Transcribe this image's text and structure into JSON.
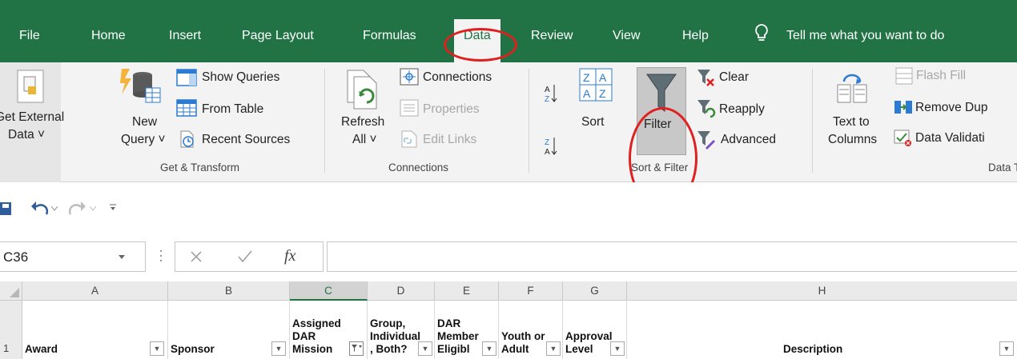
{
  "menu": {
    "tabs": [
      "File",
      "Home",
      "Insert",
      "Page Layout",
      "Formulas",
      "Data",
      "Review",
      "View",
      "Help"
    ],
    "active_tab": "Data",
    "tell_me": "Tell me what you want to do"
  },
  "ribbon": {
    "get_external": {
      "line1": "Get External",
      "line2": "Data ˅"
    },
    "new_query": {
      "line1": "New",
      "line2": "Query ˅"
    },
    "get_transform": {
      "show_queries": "Show Queries",
      "from_table": "From Table",
      "recent_sources": "Recent Sources",
      "group": "Get & Transform"
    },
    "refresh": {
      "line1": "Refresh",
      "line2": "All ˅"
    },
    "connections": {
      "connections": "Connections",
      "properties": "Properties",
      "edit_links": "Edit Links",
      "group": "Connections"
    },
    "sort_filter": {
      "sort": "Sort",
      "filter": "Filter",
      "clear": "Clear",
      "reapply": "Reapply",
      "advanced": "Advanced",
      "group": "Sort & Filter"
    },
    "data_tools": {
      "text_to_1": "Text to",
      "text_to_2": "Columns",
      "flash_fill": "Flash Fill",
      "remove_dup": "Remove Dup",
      "data_validation": "Data Validati",
      "group": "Data T"
    }
  },
  "formula_bar": {
    "name_box": "C36",
    "fx": "fx",
    "value": ""
  },
  "grid": {
    "columns": [
      "A",
      "B",
      "C",
      "D",
      "E",
      "F",
      "G",
      "H"
    ],
    "selected_column": "C",
    "row_number": "1",
    "headers": [
      "Award",
      "Sponsor",
      "Assigned\nDAR\nMission",
      "Group,\nIndividual\n, Both?",
      "DAR\nMember\nEligibl",
      "Youth or\nAdult",
      "Approval\nLevel",
      "Description"
    ]
  },
  "colors": {
    "excel_green": "#217346",
    "highlight_red": "#e0201f",
    "ribbon_bg": "#f3f3f3"
  }
}
